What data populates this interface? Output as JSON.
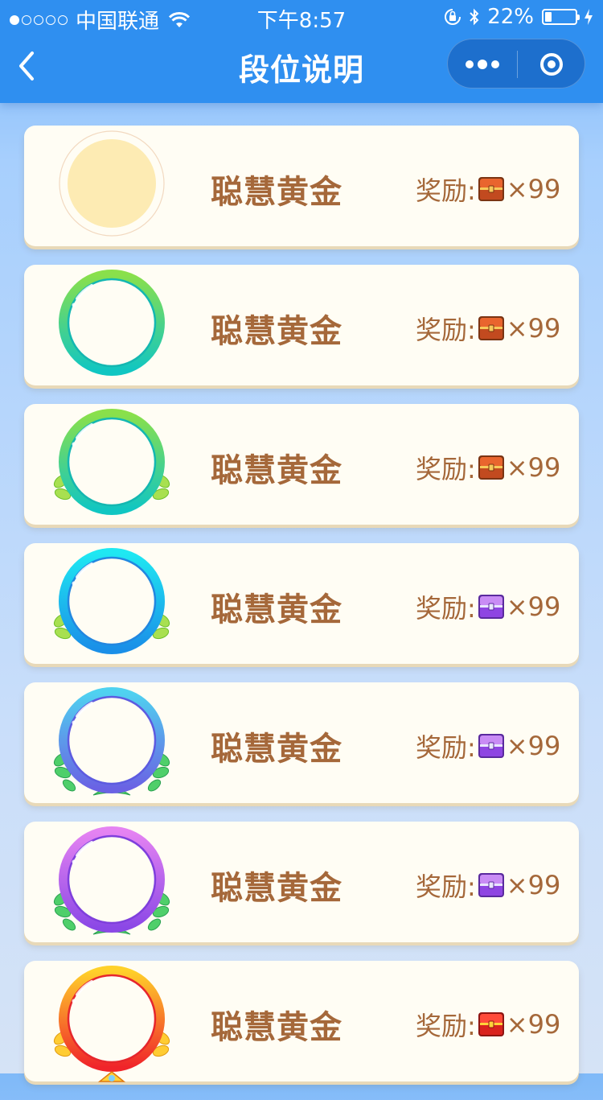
{
  "status_bar": {
    "carrier": "中国联通",
    "time": "下午8:57",
    "battery": "22%",
    "battery_level": 0.22,
    "icons": [
      "signal-dots-icon",
      "wifi-icon",
      "rotation-lock-icon",
      "bluetooth-icon",
      "battery-icon",
      "charging-icon"
    ]
  },
  "nav": {
    "title": "段位说明",
    "back_icon": "chevron-left-icon",
    "more_icon": "more-dots-icon",
    "close_icon": "target-circle-icon"
  },
  "colors": {
    "header": "#2f8ff0",
    "capsule": "#1d6fcd",
    "card_bg": "#fffdf4",
    "text_brown": "#a5683a"
  },
  "ranks": [
    {
      "title": "聪慧黄金",
      "reward_label": "奖励:",
      "reward_count": "×99",
      "badge_style": "blank",
      "chest_icon": "wooden-chest-icon"
    },
    {
      "title": "聪慧黄金",
      "reward_label": "奖励:",
      "reward_count": "×99",
      "badge_style": "green-ring",
      "chest_icon": "wooden-chest-icon"
    },
    {
      "title": "聪慧黄金",
      "reward_label": "奖励:",
      "reward_count": "×99",
      "badge_style": "green-ring-leaves",
      "chest_icon": "wooden-chest-icon"
    },
    {
      "title": "聪慧黄金",
      "reward_label": "奖励:",
      "reward_count": "×99",
      "badge_style": "blue-ring-leaves",
      "chest_icon": "purple-chest-icon"
    },
    {
      "title": "聪慧黄金",
      "reward_label": "奖励:",
      "reward_count": "×99",
      "badge_style": "indigo-ring-wreath",
      "chest_icon": "purple-chest-icon"
    },
    {
      "title": "聪慧黄金",
      "reward_label": "奖励:",
      "reward_count": "×99",
      "badge_style": "purple-ring-wreath",
      "chest_icon": "purple-chest-icon"
    },
    {
      "title": "聪慧黄金",
      "reward_label": "奖励:",
      "reward_count": "×99",
      "badge_style": "gold-ring-crown",
      "chest_icon": "red-gold-chest-icon"
    }
  ]
}
